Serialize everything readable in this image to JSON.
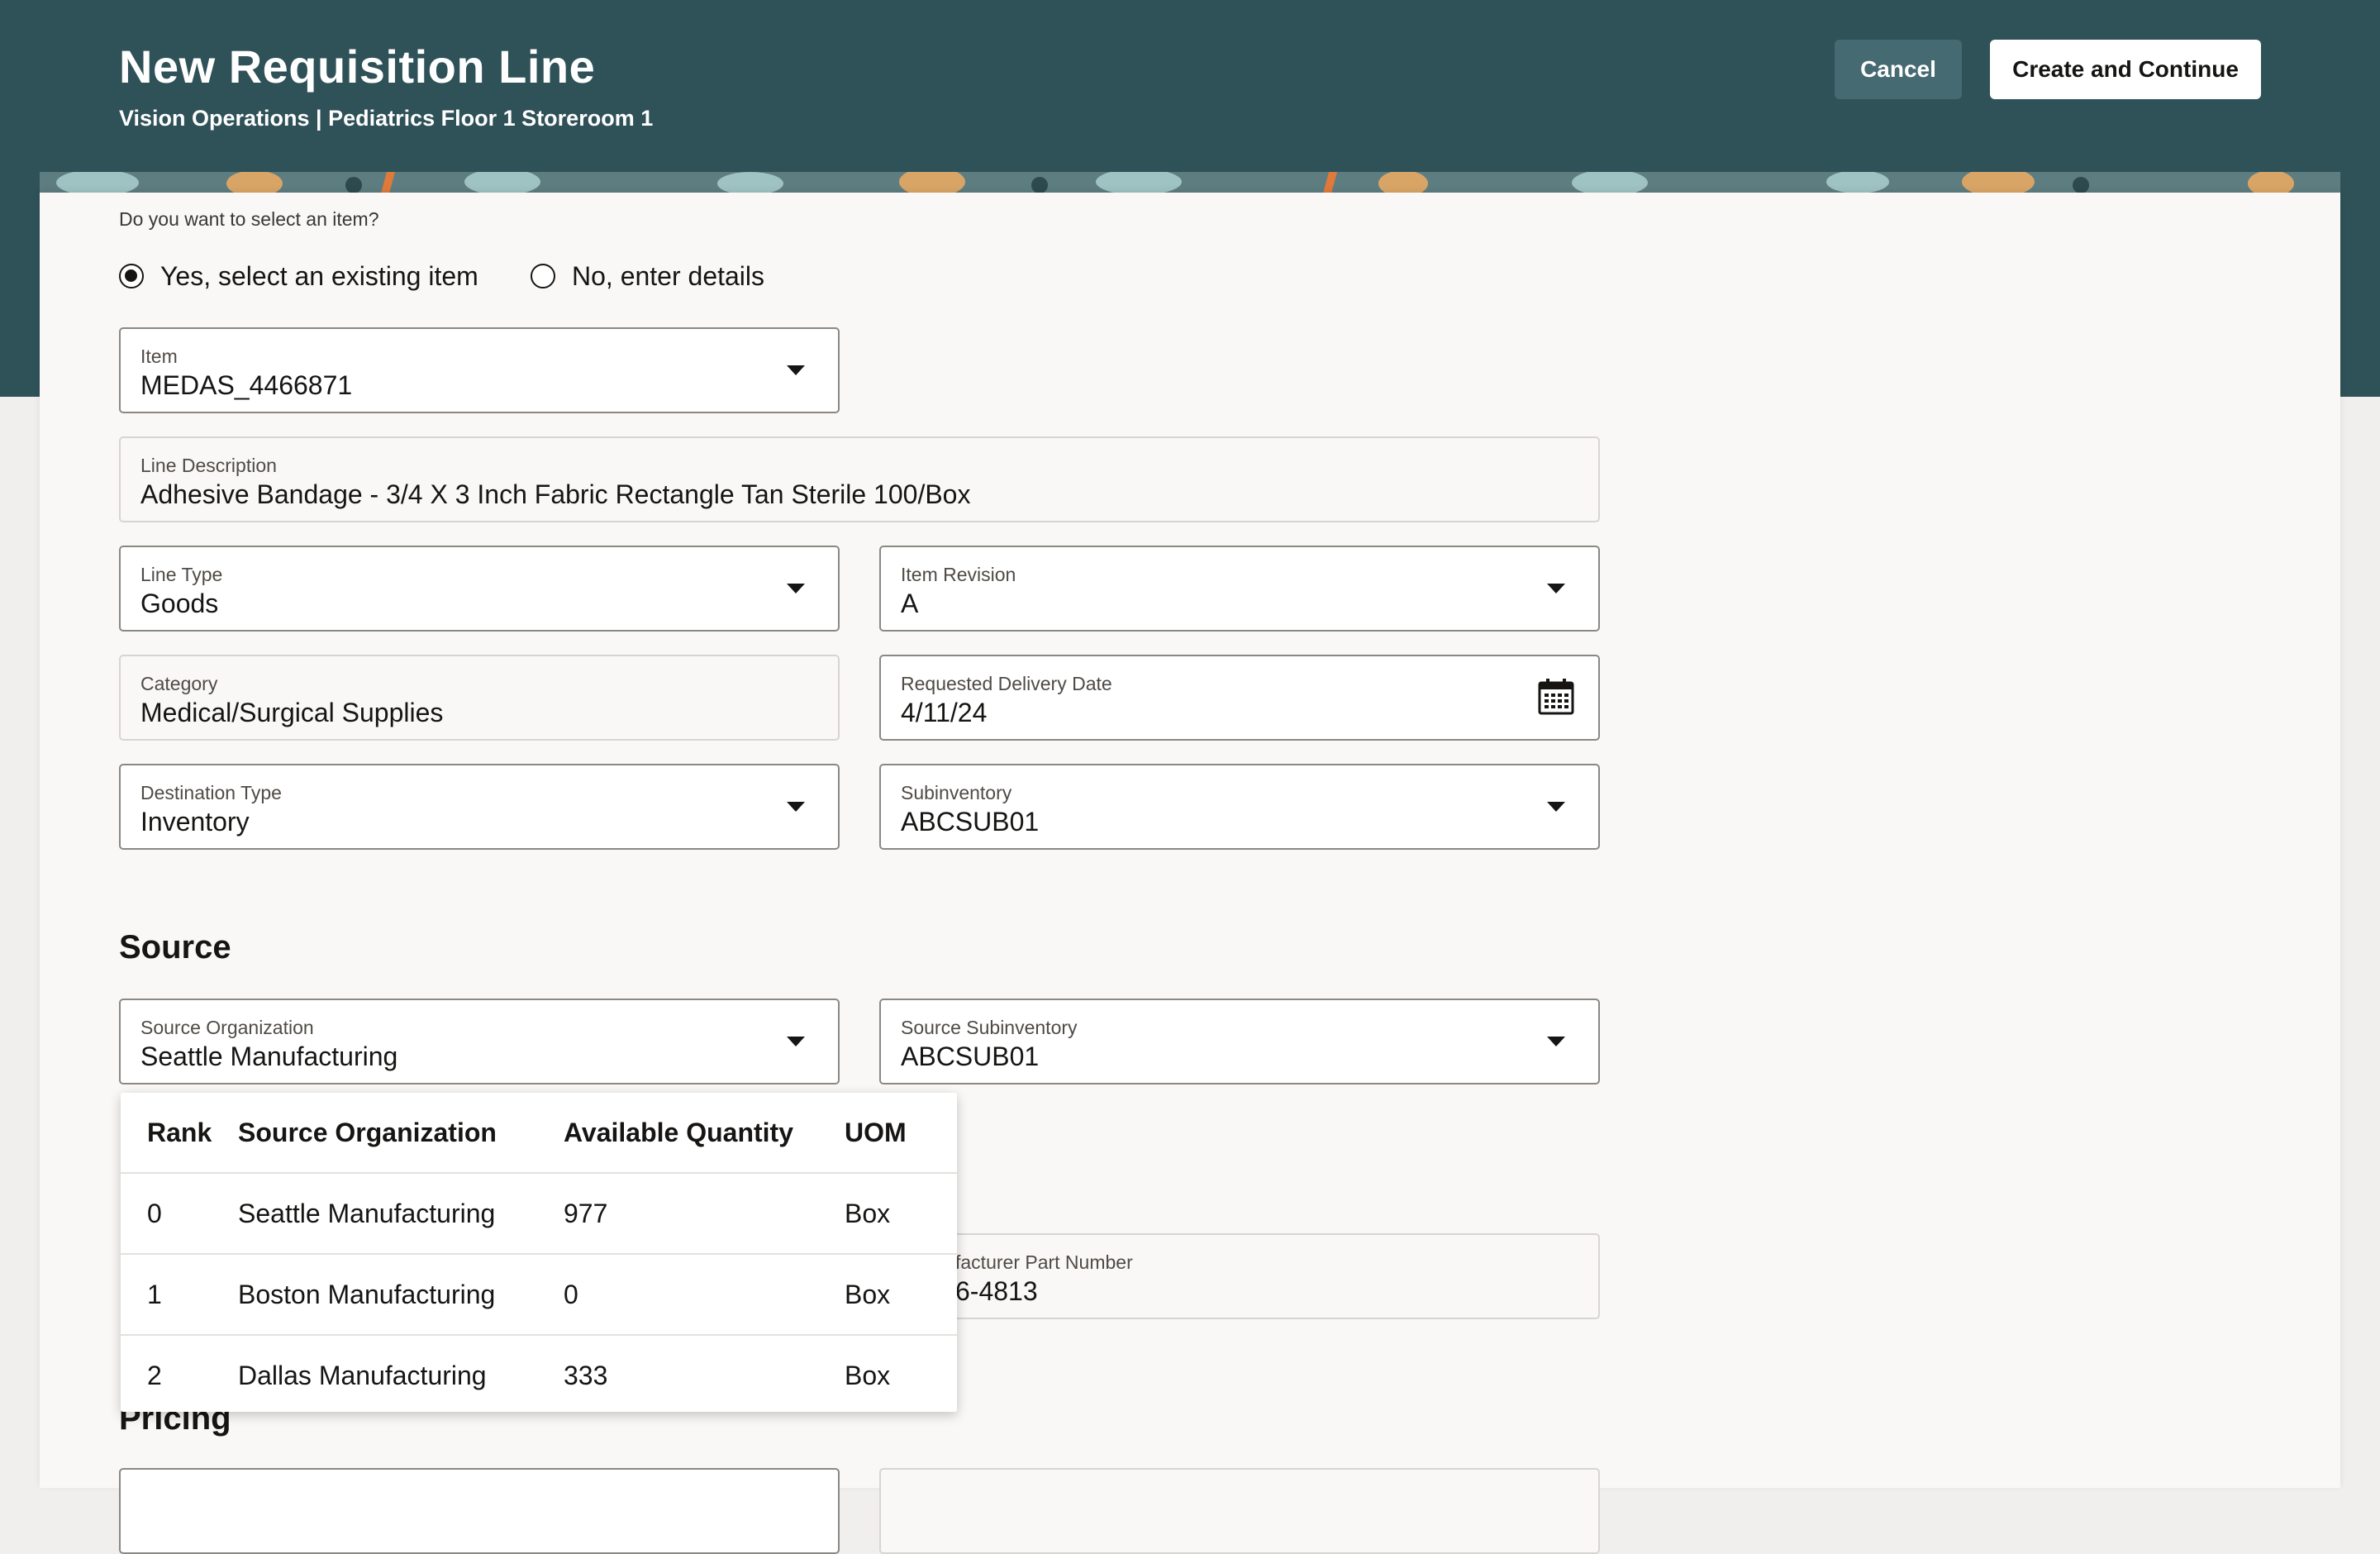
{
  "header": {
    "title": "New Requisition Line",
    "subtitle": "Vision Operations | Pediatrics Floor 1 Storeroom 1",
    "cancel_label": "Cancel",
    "create_label": "Create and Continue"
  },
  "colors": {
    "header": "#2f5158",
    "cancel_button": "#466a71",
    "sheet": "#f9f8f6"
  },
  "item_choice": {
    "question": "Do you want to select an item?",
    "options": [
      {
        "label": "Yes, select an existing item",
        "selected": true
      },
      {
        "label": "No, enter details",
        "selected": false
      }
    ]
  },
  "fields": {
    "item": {
      "label": "Item",
      "value": "MEDAS_4466871"
    },
    "line_description": {
      "label": "Line Description",
      "value": "Adhesive Bandage - 3/4 X 3 Inch Fabric Rectangle Tan Sterile 100/Box"
    },
    "line_type": {
      "label": "Line Type",
      "value": "Goods"
    },
    "item_revision": {
      "label": "Item Revision",
      "value": "A"
    },
    "category": {
      "label": "Category",
      "value": "Medical/Surgical Supplies"
    },
    "requested_delivery_date": {
      "label": "Requested Delivery Date",
      "value": "4/11/24"
    },
    "destination_type": {
      "label": "Destination Type",
      "value": "Inventory"
    },
    "subinventory": {
      "label": "Subinventory",
      "value": "ABCSUB01"
    }
  },
  "source": {
    "title": "Source",
    "organization": {
      "label": "Source Organization",
      "value": "Seattle Manufacturing"
    },
    "subinventory": {
      "label": "Source Subinventory",
      "value": "ABCSUB01"
    },
    "manufacturer_part": {
      "label": "facturer Part Number",
      "value": "6-4813"
    }
  },
  "source_popup": {
    "headers": [
      "Rank",
      "Source Organization",
      "Available Quantity",
      "UOM"
    ],
    "rows": [
      [
        "0",
        "Seattle Manufacturing",
        "977",
        "Box"
      ],
      [
        "1",
        "Boston Manufacturing",
        "0",
        "Box"
      ],
      [
        "2",
        "Dallas Manufacturing",
        "333",
        "Box"
      ]
    ]
  },
  "pricing": {
    "title": "Pricing"
  }
}
